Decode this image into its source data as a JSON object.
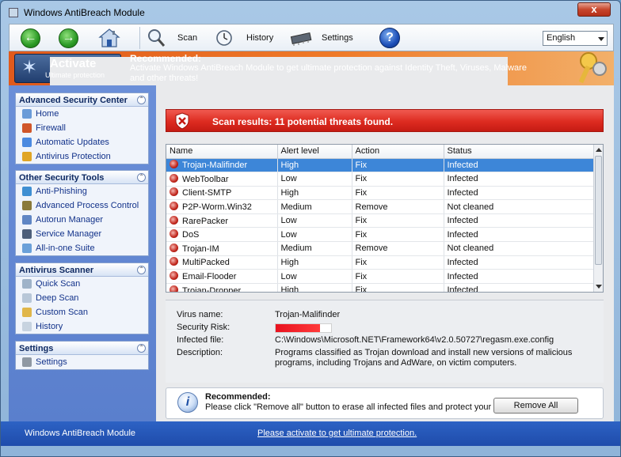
{
  "window": {
    "title": "Windows AntiBreach Module",
    "close_label": "x"
  },
  "toolbar": {
    "back_icon": "back-arrow-icon",
    "forward_icon": "forward-arrow-icon",
    "home_icon": "home-icon",
    "scan_label": "Scan",
    "history_label": "History",
    "settings_label": "Settings",
    "help_icon": "help-icon",
    "language": "English"
  },
  "banner": {
    "activate_main": "Activate",
    "activate_sub": "Ultimate protection",
    "rec_title": "Recommended:",
    "rec_text": "Activate Windows AntiBreach Module to get ultimate protection against Identity Theft, Viruses, Malware and other threats!"
  },
  "sidebar": {
    "sections": [
      {
        "title": "Advanced Security Center",
        "items": [
          {
            "label": "Home"
          },
          {
            "label": "Firewall"
          },
          {
            "label": "Automatic Updates"
          },
          {
            "label": "Antivirus Protection"
          }
        ]
      },
      {
        "title": "Other Security Tools",
        "items": [
          {
            "label": "Anti-Phishing"
          },
          {
            "label": "Advanced Process Control"
          },
          {
            "label": "Autorun Manager"
          },
          {
            "label": "Service Manager"
          },
          {
            "label": "All-in-one Suite"
          }
        ]
      },
      {
        "title": "Antivirus Scanner",
        "items": [
          {
            "label": "Quick Scan"
          },
          {
            "label": "Deep Scan"
          },
          {
            "label": "Custom Scan"
          },
          {
            "label": "History"
          }
        ]
      },
      {
        "title": "Settings",
        "items": [
          {
            "label": "Settings"
          }
        ]
      }
    ]
  },
  "scan": {
    "result_text": "Scan results: 11 potential threats found."
  },
  "grid": {
    "columns": [
      "Name",
      "Alert level",
      "Action",
      "Status"
    ],
    "rows": [
      [
        "Trojan-Malifinder",
        "High",
        "Fix",
        "Infected"
      ],
      [
        "WebToolbar",
        "Low",
        "Fix",
        "Infected"
      ],
      [
        "Client-SMTP",
        "High",
        "Fix",
        "Infected"
      ],
      [
        "P2P-Worm.Win32",
        "Medium",
        "Remove",
        "Not cleaned"
      ],
      [
        "RarePacker",
        "Low",
        "Fix",
        "Infected"
      ],
      [
        "DoS",
        "Low",
        "Fix",
        "Infected"
      ],
      [
        "Trojan-IM",
        "Medium",
        "Remove",
        "Not cleaned"
      ],
      [
        "MultiPacked",
        "High",
        "Fix",
        "Infected"
      ],
      [
        "Email-Flooder",
        "Low",
        "Fix",
        "Infected"
      ],
      [
        "Trojan-Dropper",
        "High",
        "Fix",
        "Infected"
      ]
    ]
  },
  "details": {
    "virus_label": "Virus name:",
    "virus_value": "Trojan-Malifinder",
    "risk_label": "Security Risk:",
    "risk_level": 0.8,
    "file_label": "Infected file:",
    "file_value": "C:\\Windows\\Microsoft.NET\\Framework64\\v2.0.50727\\regasm.exe.config",
    "desc_label": "Description:",
    "desc_value": "Programs classified as Trojan download and install new versions of malicious programs, including Trojans and AdWare, on victim computers."
  },
  "recommend": {
    "title": "Recommended:",
    "text": "Please click \"Remove all\" button to erase all infected files and protect your PC",
    "button": "Remove All"
  },
  "footer": {
    "name": "Windows AntiBreach Module",
    "link": "Please activate to get ultimate protection."
  },
  "colors": {
    "banner": "#ef7a28",
    "scan_bar": "#dd2b20",
    "sidebar": "#5a7fcd",
    "selected_row": "#3d86d8",
    "footer": "#2357b8"
  }
}
